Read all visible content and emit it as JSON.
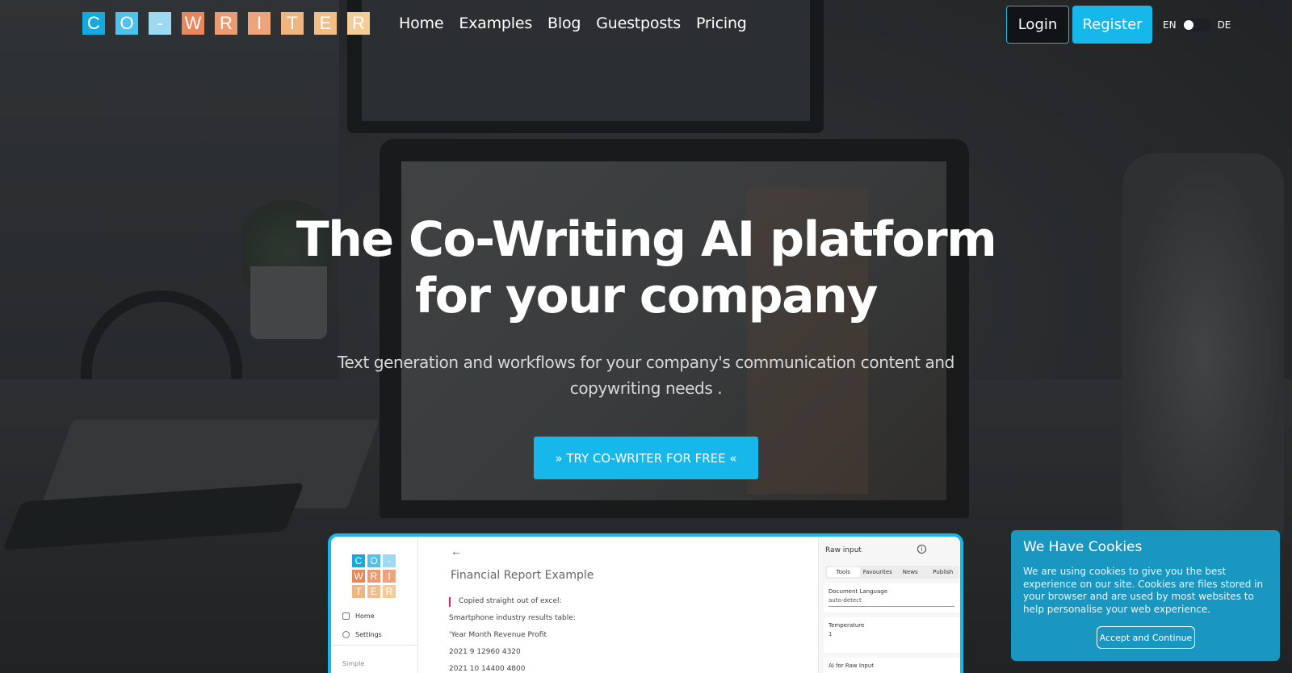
{
  "brand": {
    "logo_letters": [
      {
        "char": "C",
        "color": "#16a9e0"
      },
      {
        "char": "O",
        "color": "#4fc1ea"
      },
      {
        "char": "-",
        "color": "#9ed9f2"
      },
      {
        "char": "W",
        "color": "#e8875b"
      },
      {
        "char": "R",
        "color": "#eb9b72"
      },
      {
        "char": "I",
        "color": "#eda47a"
      },
      {
        "char": "T",
        "color": "#f0b47f"
      },
      {
        "char": "E",
        "color": "#f2bd86"
      },
      {
        "char": "R",
        "color": "#f4cc97"
      }
    ]
  },
  "nav": {
    "items": [
      "Home",
      "Examples",
      "Blog",
      "Guestposts",
      "Pricing"
    ]
  },
  "auth": {
    "login_label": "Login",
    "register_label": "Register"
  },
  "language": {
    "left": "EN",
    "right": "DE",
    "selected": "EN"
  },
  "hero": {
    "title_line1": "The Co-Writing AI platform",
    "title_line2": "for your company",
    "subtitle": "Text generation and workflows for your company's communication content and copywriting needs .",
    "cta_label": "» TRY CO-WRITER FOR FREE «"
  },
  "preview": {
    "logo_letters": [
      {
        "char": "C",
        "color": "#16a9e0"
      },
      {
        "char": "O",
        "color": "#4fc1ea"
      },
      {
        "char": "-",
        "color": "#9ed9f2"
      },
      {
        "char": "W",
        "color": "#e8875b"
      },
      {
        "char": "R",
        "color": "#eb9b72"
      },
      {
        "char": "I",
        "color": "#eda47a"
      },
      {
        "char": "T",
        "color": "#f0b47f"
      },
      {
        "char": "E",
        "color": "#f2bd86"
      },
      {
        "char": "R",
        "color": "#f4cc97"
      }
    ],
    "sidebar": {
      "home": "Home",
      "settings": "Settings",
      "section": "Simple"
    },
    "doc_title": "Financial Report Example",
    "lines": [
      "Copied straight out of excel:",
      "Smartphone industry results table:",
      "'Year Month Revenue Profit",
      "2021 9 12960 4320",
      "2021 10 14400 4800"
    ],
    "panel": {
      "title": "Raw input",
      "tabs": [
        "Tools",
        "Favourites",
        "News",
        "Publish"
      ],
      "active_tab": "Tools",
      "doc_lang_label": "Document Language",
      "doc_lang_value": "auto-detect",
      "temperature_label": "Temperature",
      "temperature_value": "1",
      "ai_label": "AI for Raw Input"
    }
  },
  "cookie": {
    "title": "We Have Cookies",
    "text": "We are using cookies to give you the best experience on our site. Cookies are files stored in your browser and are used by most websites to help personalise your web experience.",
    "button": "Accept and Continue"
  },
  "colors": {
    "accent": "#16b7ea",
    "cookie_bg": "#1a97c1"
  }
}
